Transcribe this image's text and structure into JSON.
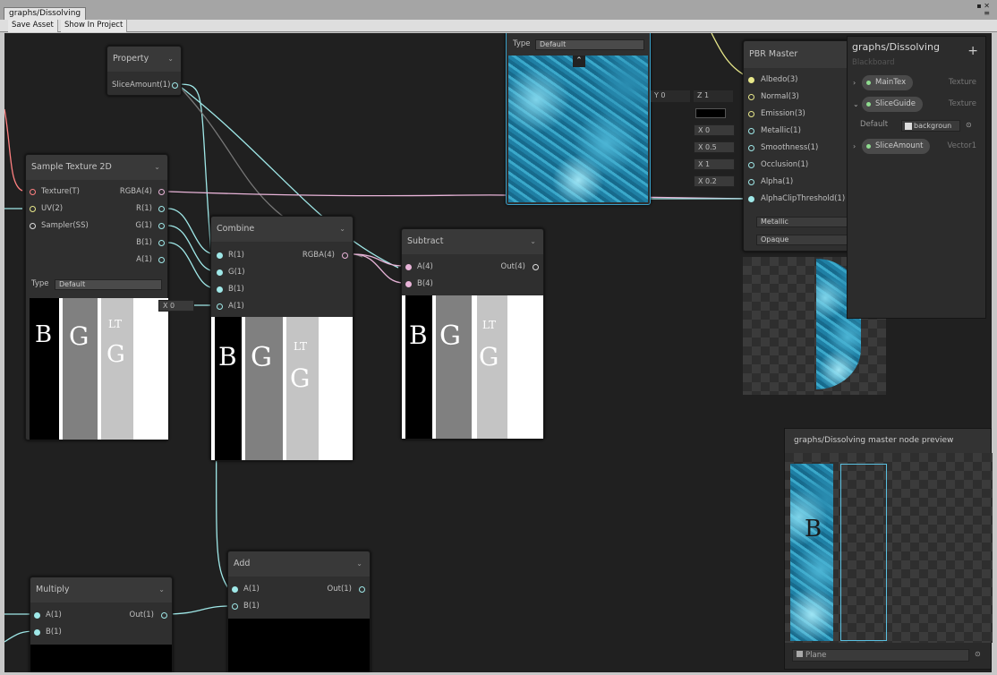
{
  "window": {
    "tab_title": "graphs/Dissolving",
    "window_controls": "▪ ✕\n≡"
  },
  "toolbar": {
    "save_asset": "Save Asset",
    "show_in_project": "Show In Project"
  },
  "nodes": {
    "property": {
      "title": "Property",
      "output": "SliceAmount(1)"
    },
    "sample_texture": {
      "title": "Sample Texture 2D",
      "inputs": [
        "Texture(T)",
        "UV(2)",
        "Sampler(SS)"
      ],
      "outputs": [
        "RGBA(4)",
        "R(1)",
        "G(1)",
        "B(1)",
        "A(1)"
      ],
      "type_label": "Type",
      "type_value": "Default"
    },
    "combine": {
      "title": "Combine",
      "inputs": [
        "R(1)",
        "G(1)",
        "B(1)",
        "A(1)"
      ],
      "outputs": [
        "RGBA(4)"
      ],
      "a_default": "X 0"
    },
    "subtract": {
      "title": "Subtract",
      "inputs": [
        "A(4)",
        "B(4)"
      ],
      "outputs": [
        "Out(4)"
      ]
    },
    "texture_top": {
      "type_label": "Type",
      "type_value": "Default"
    },
    "pbr": {
      "title": "PBR Master",
      "inputs": [
        "Albedo(3)",
        "Normal(3)",
        "Emission(3)",
        "Metallic(1)",
        "Smoothness(1)",
        "Occlusion(1)",
        "Alpha(1)",
        "AlphaClipThreshold(1)"
      ],
      "normal_y": "Y 0",
      "normal_z": "Z 1",
      "metallic_value": "X 0",
      "smoothness_value": "X 0.5",
      "occlusion_value": "X 1",
      "alpha_value": "X 0.2",
      "workflow": "Metallic",
      "surface": "Opaque"
    },
    "add": {
      "title": "Add",
      "inputs": [
        "A(1)",
        "B(1)"
      ],
      "outputs": [
        "Out(1)"
      ]
    },
    "multiply": {
      "title": "Multiply",
      "inputs": [
        "A(1)",
        "B(1)"
      ],
      "outputs": [
        "Out(1)"
      ]
    },
    "preview_letters": {
      "b": "B",
      "g": "G",
      "lt": "LT"
    }
  },
  "blackboard": {
    "title": "graphs/Dissolving",
    "subtitle": "Blackboard",
    "add": "+",
    "properties": [
      {
        "name": "MainTex",
        "type": "Texture"
      },
      {
        "name": "SliceGuide",
        "type": "Texture"
      },
      {
        "name": "SliceAmount",
        "type": "Vector1"
      }
    ],
    "default_label": "Default",
    "default_value": "backgroun"
  },
  "master_preview": {
    "title": "graphs/Dissolving master node preview",
    "mesh": "Plane"
  },
  "colors": {
    "canvas": "#202020",
    "wire_float": "#9fe8e8",
    "wire_vector4": "#e8b4d8",
    "wire_vector3": "#e8e88a"
  }
}
